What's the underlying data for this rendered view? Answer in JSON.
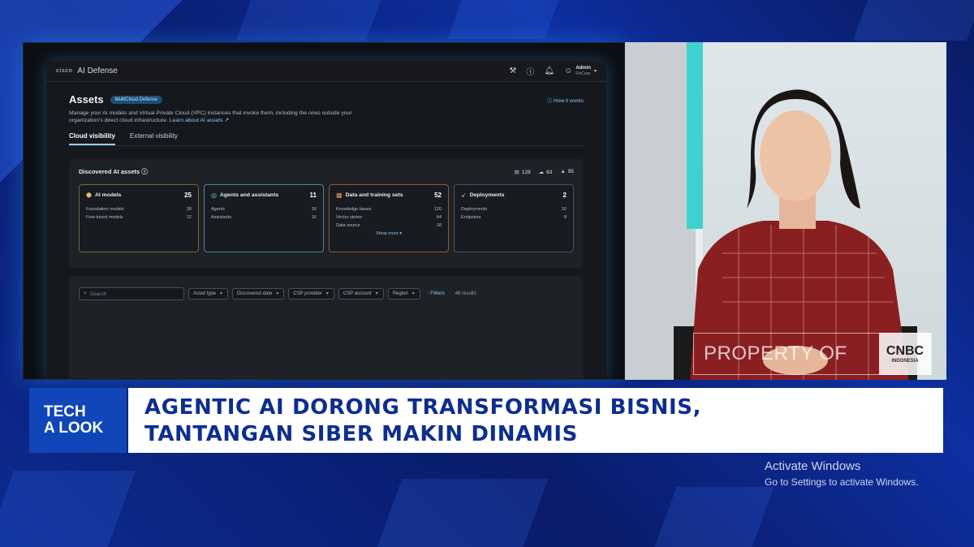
{
  "app": {
    "vendor": "cisco",
    "title": "AI Defense",
    "user": {
      "name": "Admin",
      "org": "FinCorp"
    }
  },
  "page": {
    "title": "Assets",
    "badge": "MultiCloud Defense",
    "how_it_works": "How it works",
    "description": "Manage your AI models and Virtual Private Cloud (VPC) instances that invoke them, including the ones outside your organization's direct cloud infrastructure.",
    "learn_more": "Learn about AI assets",
    "tabs": [
      "Cloud visibility",
      "External visibility"
    ]
  },
  "discovered": {
    "title": "Discovered AI assets",
    "counts": [
      {
        "icon": "aws-icon",
        "value": "128"
      },
      {
        "icon": "gcp-icon",
        "value": "63"
      },
      {
        "icon": "azure-icon",
        "value": "95"
      }
    ],
    "cards": [
      {
        "title": "AI models",
        "total": "25",
        "rows": [
          {
            "label": "Foundation models",
            "value": "38"
          },
          {
            "label": "Fine-tuned models",
            "value": "12"
          }
        ]
      },
      {
        "title": "Agents and assistants",
        "total": "11",
        "rows": [
          {
            "label": "Agents",
            "value": "16"
          },
          {
            "label": "Assistants",
            "value": "16"
          }
        ]
      },
      {
        "title": "Data and training sets",
        "total": "52",
        "rows": [
          {
            "label": "Knowledge bases",
            "value": "120"
          },
          {
            "label": "Vector stores",
            "value": "64"
          },
          {
            "label": "Data source",
            "value": "18"
          }
        ],
        "show_more": "Show more"
      },
      {
        "title": "Deployments",
        "total": "2",
        "rows": [
          {
            "label": "Deployments",
            "value": "10"
          },
          {
            "label": "Endpoints",
            "value": "8"
          }
        ]
      }
    ]
  },
  "filters": {
    "search_placeholder": "Search",
    "dropdowns": [
      "Asset type",
      "Discovered date",
      "CSP provider",
      "CSP account",
      "Region"
    ],
    "filters_label": "Filters",
    "results": "48 results"
  },
  "broadcast": {
    "watermark": "PROPERTY OF",
    "logo_line1": "CNBC",
    "logo_line2": "INDONESIA",
    "segment_line1": "TECH",
    "segment_line2": "A LOOK",
    "headline_line1": "AGENTIC AI DORONG TRANSFORMASI BISNIS,",
    "headline_line2": "TANTANGAN SIBER MAKIN DINAMIS"
  },
  "os_notice": {
    "title": "Activate Windows",
    "subtitle": "Go to Settings to activate Windows."
  },
  "colors": {
    "accent": "#8ec5ff",
    "headline": "#0d2e8e",
    "segment_bg": "#1046b8",
    "teal": "#3fd1cf"
  }
}
